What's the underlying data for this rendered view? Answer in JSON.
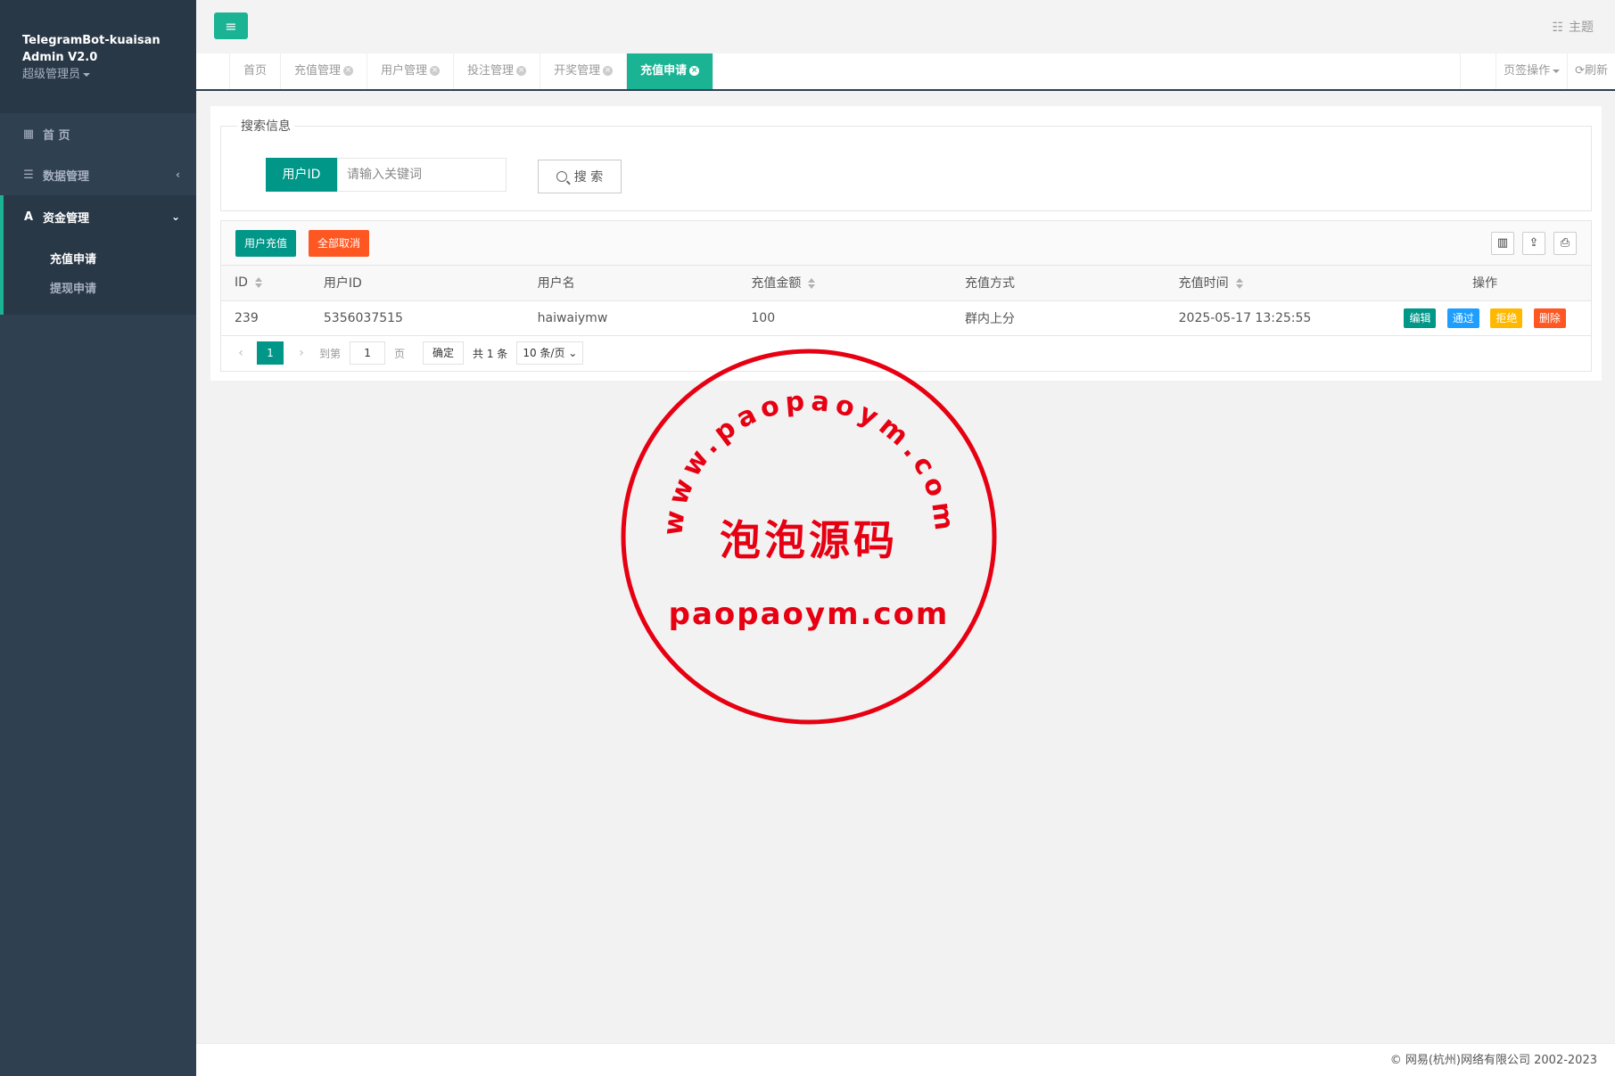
{
  "sidebar": {
    "brand_line1": "TelegramBot-kuaisan",
    "brand_line2": "Admin V2.0",
    "role": "超级管理员",
    "items": [
      {
        "label": "首 页",
        "icon": "grid-icon"
      },
      {
        "label": "数据管理",
        "icon": "list-icon"
      },
      {
        "label": "资金管理",
        "icon": "fund-icon"
      }
    ],
    "sub_items": [
      {
        "label": "充值申请"
      },
      {
        "label": "提现申请"
      }
    ]
  },
  "topbar": {
    "theme_label": "主题"
  },
  "tabs": [
    {
      "label": "首页",
      "closable": false
    },
    {
      "label": "充值管理",
      "closable": true
    },
    {
      "label": "用户管理",
      "closable": true
    },
    {
      "label": "投注管理",
      "closable": true
    },
    {
      "label": "开奖管理",
      "closable": true
    },
    {
      "label": "充值申请",
      "closable": true,
      "active": true
    }
  ],
  "tab_actions": {
    "page_ops": "页签操作",
    "refresh": "刷新"
  },
  "search": {
    "legend": "搜索信息",
    "field_label": "用户ID",
    "placeholder": "请输入关键词",
    "button": "搜 索"
  },
  "toolbar": {
    "charge": "用户充值",
    "cancel_all": "全部取消"
  },
  "table": {
    "headers": [
      "ID",
      "用户ID",
      "用户名",
      "充值金额",
      "充值方式",
      "充值时间",
      "操作"
    ],
    "rows": [
      {
        "id": "239",
        "user_id": "5356037515",
        "username": "haiwaiymw",
        "amount": "100",
        "method": "群内上分",
        "time": "2025-05-17 13:25:55"
      }
    ],
    "actions": {
      "edit": "编辑",
      "pass": "通过",
      "reject": "拒绝",
      "delete": "删除"
    }
  },
  "pager": {
    "current": "1",
    "goto": "到第",
    "page_input": "1",
    "page": "页",
    "confirm": "确定",
    "total": "共 1 条",
    "size": "10 条/页"
  },
  "watermark": {
    "top_arc": "www.paopaoym.com",
    "center": "泡泡源码",
    "bottom": "paopaoym.com"
  },
  "footer": {
    "copyright": "© 网易(杭州)网络有限公司 2002-2023"
  },
  "colors": {
    "primary": "#009688",
    "accent_green": "#1ab394",
    "sidebar": "#2f4050",
    "danger": "#ff5722",
    "info": "#1e9fff",
    "warn": "#ffb800",
    "stamp": "#e60012"
  }
}
